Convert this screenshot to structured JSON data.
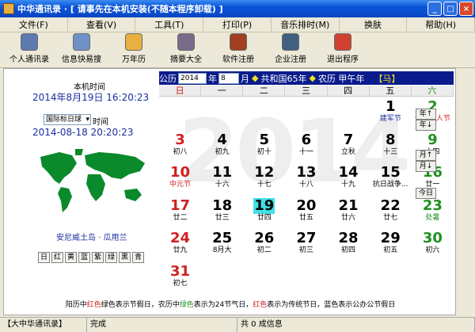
{
  "window": {
    "title": "中华通讯录 · [ 请事先在本机安装(不随本程序卸载) ]",
    "buttons": {
      "minimize": "_",
      "maximize": "□",
      "close": "×"
    }
  },
  "menu": [
    {
      "label": "文件(F)"
    },
    {
      "label": "查看(V)"
    },
    {
      "label": "工具(T)"
    },
    {
      "label": "打印(P)"
    },
    {
      "label": "音乐排时(M)"
    },
    {
      "label": "换肤"
    },
    {
      "label": "帮助(H)"
    }
  ],
  "toolbar": [
    {
      "label": "个人通讯录",
      "icon": "contacts-icon",
      "color": "#5a7ab0"
    },
    {
      "label": "信息快易搜",
      "icon": "search-info-icon",
      "color": "#7090c8"
    },
    {
      "label": "万年历",
      "icon": "calendar-icon",
      "color": "#e8b040"
    },
    {
      "label": "摘要大全",
      "icon": "notes-icon",
      "color": "#7a6a8a"
    },
    {
      "label": "软件注册",
      "icon": "register-icon",
      "color": "#a04020"
    },
    {
      "label": "企业注册",
      "icon": "company-icon",
      "color": "#406080"
    },
    {
      "label": "退出程序",
      "icon": "exit-icon",
      "color": "#d04030"
    }
  ],
  "left": {
    "local_time_label": "本机时间",
    "local_time_value": "2014年8月19日   16:20:23",
    "tz_select": "国际标日球",
    "tz_suffix": "时间",
    "world_time_value": "2014-08-18 20:20:23",
    "city_label": "安尼威土岛 · 瓜用兰",
    "city_buttons": [
      "日",
      "红",
      "黄",
      "蓝",
      "紫",
      "绿",
      "黑",
      "青"
    ]
  },
  "calendar": {
    "header": {
      "prefix": "公历",
      "year": "2014",
      "year_suffix": "年",
      "month": "8",
      "month_suffix": "月",
      "republic": "共和国65年",
      "lunar": "农历  甲午年",
      "zodiac": "【马】"
    },
    "watermark_year": "2014",
    "weekdays": [
      "日",
      "一",
      "二",
      "三",
      "四",
      "五",
      "六"
    ],
    "weeks": [
      [
        null,
        null,
        null,
        null,
        null,
        {
          "d": "1",
          "s": "建军节",
          "c": "#1a2ea0"
        },
        {
          "d": "2",
          "s": "七夕情人节",
          "c": "#d02020"
        }
      ],
      [
        {
          "d": "3",
          "s": "初八"
        },
        {
          "d": "4",
          "s": "初九"
        },
        {
          "d": "5",
          "s": "初十"
        },
        {
          "d": "6",
          "s": "十一"
        },
        {
          "d": "7",
          "s": "立秋"
        },
        {
          "d": "8",
          "s": "十三"
        },
        {
          "d": "9",
          "s": "十四"
        }
      ],
      [
        {
          "d": "10",
          "s": "中元节",
          "c": "#d02020"
        },
        {
          "d": "11",
          "s": "十六"
        },
        {
          "d": "12",
          "s": "十七"
        },
        {
          "d": "13",
          "s": "十八"
        },
        {
          "d": "14",
          "s": "十九"
        },
        {
          "d": "15",
          "s": "抗日战争..."
        },
        {
          "d": "16",
          "s": "廿一"
        }
      ],
      [
        {
          "d": "17",
          "s": "廿二"
        },
        {
          "d": "18",
          "s": "廿三"
        },
        {
          "d": "19",
          "s": "廿四",
          "today": true
        },
        {
          "d": "20",
          "s": "廿五"
        },
        {
          "d": "21",
          "s": "廿六"
        },
        {
          "d": "22",
          "s": "廿七"
        },
        {
          "d": "23",
          "s": "处暑",
          "c": "#209020"
        }
      ],
      [
        {
          "d": "24",
          "s": "廿九"
        },
        {
          "d": "25",
          "s": "8月大"
        },
        {
          "d": "26",
          "s": "初二"
        },
        {
          "d": "27",
          "s": "初三"
        },
        {
          "d": "28",
          "s": "初四"
        },
        {
          "d": "29",
          "s": "初五"
        },
        {
          "d": "30",
          "s": "初六"
        }
      ],
      [
        {
          "d": "31",
          "s": "初七"
        },
        null,
        null,
        null,
        null,
        null,
        null
      ]
    ],
    "side_buttons": [
      "年↑",
      "年↓",
      "月↑",
      "月↓",
      "今日"
    ],
    "legend_parts": [
      {
        "t": "阳历中",
        "c": ""
      },
      {
        "t": "红色",
        "c": "red"
      },
      {
        "t": "绿色表示节假日，农历中",
        "c": ""
      },
      {
        "t": "绿色",
        "c": "green"
      },
      {
        "t": "表示为24节气日，",
        "c": ""
      },
      {
        "t": "红色",
        "c": "red"
      },
      {
        "t": "表示为传统节日，",
        "c": ""
      },
      {
        "t": "蓝色表示公办公节假日",
        "c": ""
      }
    ]
  },
  "status": [
    {
      "text": "【大中华通讯录】",
      "width": 110
    },
    {
      "text": "完成",
      "width": 190
    },
    {
      "text": "共 0 成信息",
      "width": 300
    }
  ],
  "colors": {
    "accent": "#0a1c8c",
    "today": "#40e0e8",
    "sunday": "#d02020",
    "saturday": "#209020"
  }
}
